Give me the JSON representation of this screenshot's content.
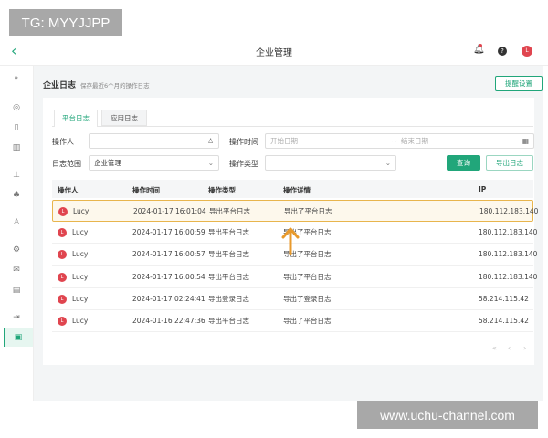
{
  "watermark_top": "TG: MYYJJPP",
  "watermark_bottom": "www.uchu-channel.com",
  "header": {
    "title": "企业管理",
    "avatar_letter": "L"
  },
  "page": {
    "title": "企业日志",
    "subtitle": "保存最近6个月的操作日志",
    "reminder_button": "提醒设置"
  },
  "tabs": [
    {
      "label": "平台日志",
      "active": true
    },
    {
      "label": "应用日志",
      "active": false
    }
  ],
  "filters": {
    "operator_label": "操作人",
    "operator_value": "",
    "time_label": "操作时间",
    "start_placeholder": "开始日期",
    "range_sep": "~",
    "end_placeholder": "结束日期",
    "scope_label": "日志范围",
    "scope_value": "企业管理",
    "type_label": "操作类型",
    "type_value": "",
    "query_button": "查询",
    "export_button": "导出日志"
  },
  "table": {
    "headers": [
      "操作人",
      "操作时间",
      "操作类型",
      "操作详情",
      "IP"
    ],
    "rows": [
      {
        "user": "Lucy",
        "time": "2024-01-17 16:01:04",
        "type": "导出平台日志",
        "detail": "导出了平台日志",
        "ip": "180.112.183.140",
        "highlighted": true
      },
      {
        "user": "Lucy",
        "time": "2024-01-17 16:00:59",
        "type": "导出平台日志",
        "detail": "导出了平台日志",
        "ip": "180.112.183.140"
      },
      {
        "user": "Lucy",
        "time": "2024-01-17 16:00:57",
        "type": "导出平台日志",
        "detail": "导出了平台日志",
        "ip": "180.112.183.140"
      },
      {
        "user": "Lucy",
        "time": "2024-01-17 16:00:54",
        "type": "导出平台日志",
        "detail": "导出了平台日志",
        "ip": "180.112.183.140"
      },
      {
        "user": "Lucy",
        "time": "2024-01-17 02:24:41",
        "type": "导出登录日志",
        "detail": "导出了登录日志",
        "ip": "58.214.115.42"
      },
      {
        "user": "Lucy",
        "time": "2024-01-16 22:47:36",
        "type": "导出平台日志",
        "detail": "导出了平台日志",
        "ip": "58.214.115.42"
      }
    ]
  },
  "colors": {
    "accent": "#21a67a",
    "highlight_border": "#e8b54d",
    "highlight_bg": "#fdf8ec",
    "avatar": "#e0454f",
    "arrow": "#e89a2c"
  }
}
